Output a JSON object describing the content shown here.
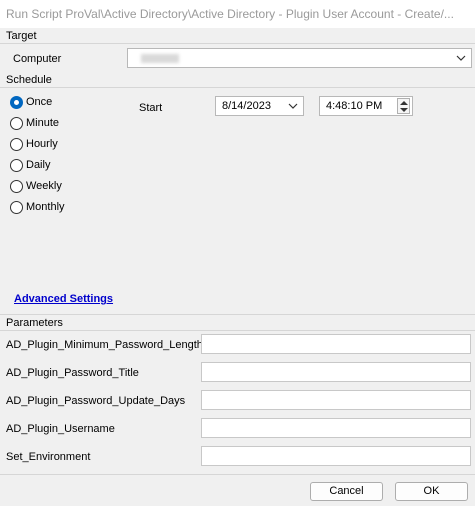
{
  "window": {
    "title": "Run Script ProVal\\Active Directory\\Active Directory - Plugin User Account - Create/..."
  },
  "target": {
    "section_label": "Target",
    "computer_label": "Computer",
    "computer_value": ""
  },
  "schedule": {
    "section_label": "Schedule",
    "options": [
      {
        "label": "Once",
        "checked": true
      },
      {
        "label": "Minute",
        "checked": false
      },
      {
        "label": "Hourly",
        "checked": false
      },
      {
        "label": "Daily",
        "checked": false
      },
      {
        "label": "Weekly",
        "checked": false
      },
      {
        "label": "Monthly",
        "checked": false
      }
    ],
    "start_label": "Start",
    "start_date": "8/14/2023",
    "start_time": "4:48:10 PM"
  },
  "advanced_settings_link": "Advanced Settings",
  "parameters": {
    "section_label": "Parameters",
    "items": [
      {
        "label": "AD_Plugin_Minimum_Password_Length",
        "value": ""
      },
      {
        "label": "AD_Plugin_Password_Title",
        "value": ""
      },
      {
        "label": "AD_Plugin_Password_Update_Days",
        "value": ""
      },
      {
        "label": "AD_Plugin_Username",
        "value": ""
      },
      {
        "label": "Set_Environment",
        "value": ""
      }
    ]
  },
  "footer": {
    "cancel_label": "Cancel",
    "ok_label": "OK"
  },
  "colors": {
    "accent": "#0067c0",
    "link": "#0000cc",
    "background": "#f0f0f0"
  }
}
